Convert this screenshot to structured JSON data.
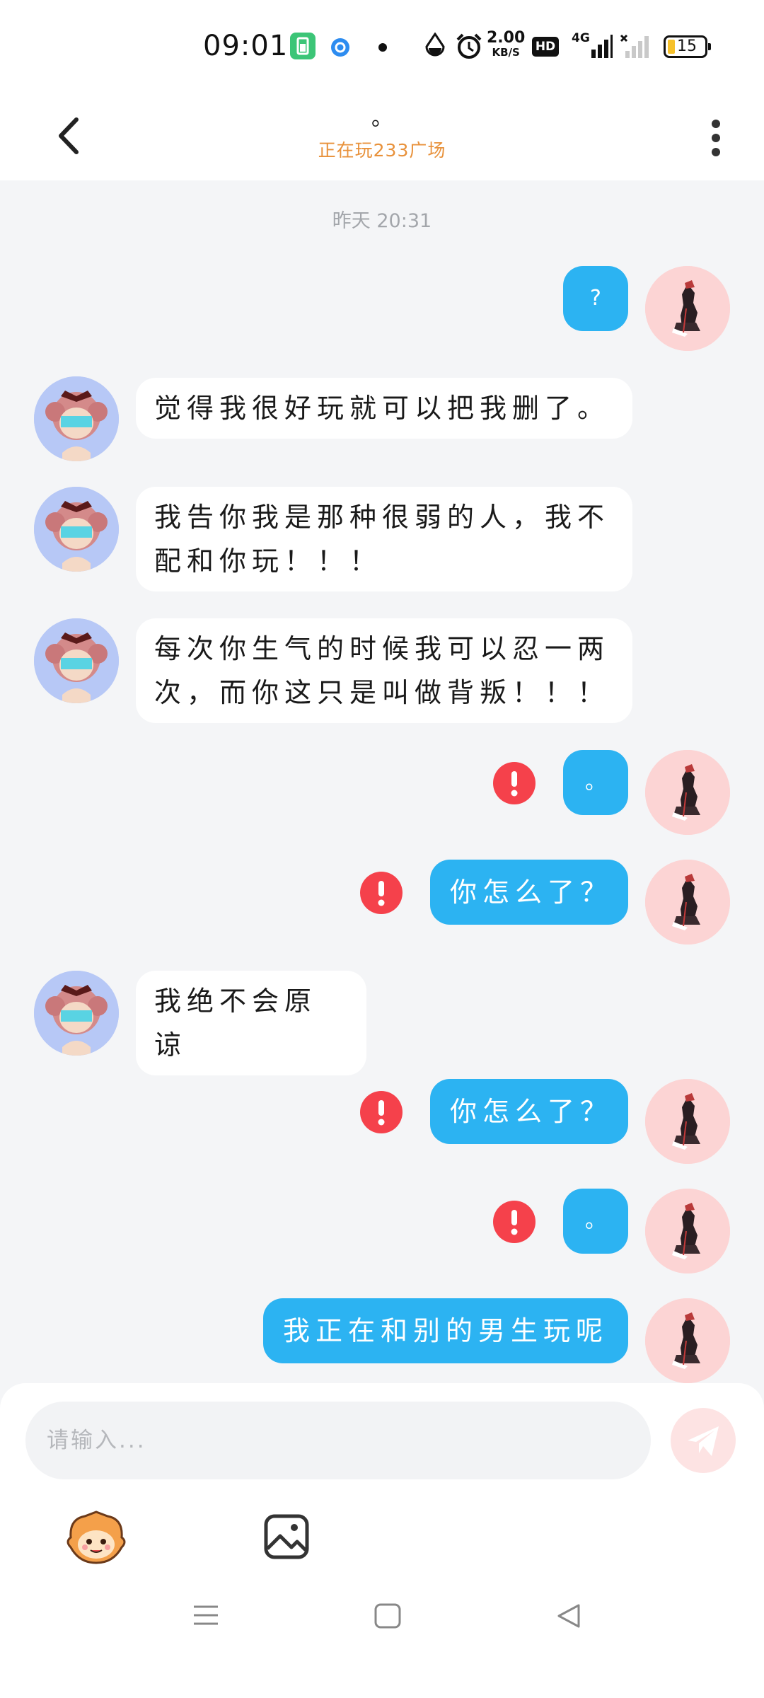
{
  "status_bar": {
    "time": "09:01",
    "speed_value": "2.00",
    "speed_unit": "KB/S",
    "hd_label": "HD",
    "network_label": "4G",
    "battery_level": "15"
  },
  "header": {
    "title": "。",
    "subtitle": "正在玩233广场"
  },
  "timestamp": "昨天 20:31",
  "messages": [
    {
      "from": "me",
      "text": "?",
      "failed": false
    },
    {
      "from": "them",
      "text": "觉得我很好玩就可以把我删了。"
    },
    {
      "from": "them",
      "text": "我告你我是那种很弱的人，我不配和你玩！！！"
    },
    {
      "from": "them",
      "text": "每次你生气的时候我可以忍一两次，而你这只是叫做背叛！！！"
    },
    {
      "from": "me",
      "text": "。",
      "failed": true
    },
    {
      "from": "me",
      "text": "你怎么了？",
      "failed": true
    },
    {
      "from": "them",
      "text": "我绝不会原谅"
    },
    {
      "from": "me",
      "text": "你怎么了？",
      "failed": true
    },
    {
      "from": "me",
      "text": "。",
      "failed": true
    },
    {
      "from": "me",
      "text": "我正在和别的男生玩呢",
      "failed": false
    }
  ],
  "input": {
    "placeholder": "请输入..."
  },
  "colors": {
    "accent_blue": "#2cb3f2",
    "error_red": "#f5414b",
    "subtitle_orange": "#e8913a"
  },
  "icons": {
    "back": "chevron-left-icon",
    "more": "more-vertical-icon",
    "error": "error-icon",
    "send": "send-icon",
    "emoji": "mascot-emoji-icon",
    "image": "image-icon"
  }
}
